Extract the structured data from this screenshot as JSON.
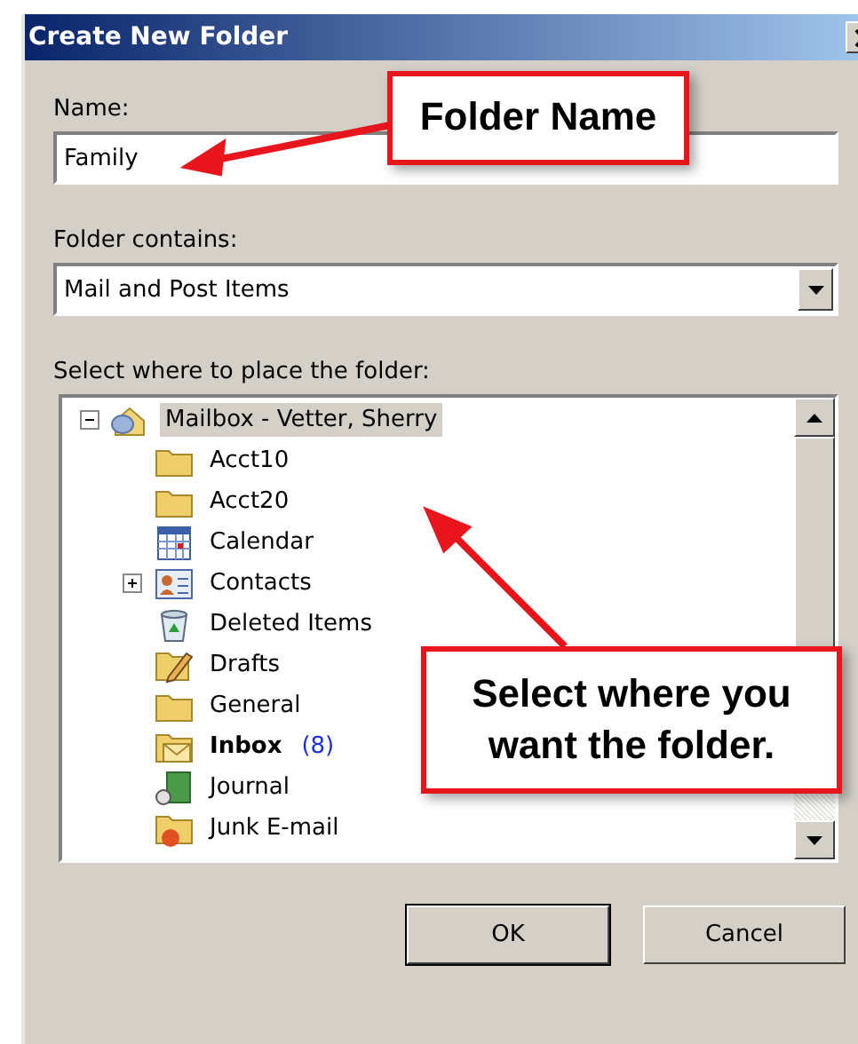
{
  "window": {
    "title": "Create New Folder"
  },
  "name_field": {
    "label": "Name:",
    "value": "Family"
  },
  "contains_field": {
    "label": "Folder contains:",
    "value": "Mail and Post Items"
  },
  "tree": {
    "label": "Select where to place the folder:",
    "root": {
      "label": "Mailbox - Vetter, Sherry",
      "kind": "mailbox",
      "selected": true,
      "expanded": true,
      "children": [
        {
          "label": "Acct10",
          "kind": "folder",
          "selected": false
        },
        {
          "label": "Acct20",
          "kind": "folder",
          "selected": false
        },
        {
          "label": "Calendar",
          "kind": "calendar",
          "selected": false
        },
        {
          "label": "Contacts",
          "kind": "contacts",
          "selected": false,
          "expanded": false
        },
        {
          "label": "Deleted Items",
          "kind": "deleted",
          "selected": false
        },
        {
          "label": "Drafts",
          "kind": "drafts",
          "selected": false
        },
        {
          "label": "General",
          "kind": "folder",
          "selected": false
        },
        {
          "label": "Inbox",
          "kind": "inbox",
          "selected": false,
          "count": "(8)"
        },
        {
          "label": "Journal",
          "kind": "journal",
          "selected": false
        },
        {
          "label": "Junk E-mail",
          "kind": "junk",
          "selected": false
        }
      ]
    }
  },
  "buttons": [
    {
      "label": "OK",
      "default": true
    },
    {
      "label": "Cancel",
      "default": false
    }
  ],
  "callouts": [
    {
      "text": "Folder Name"
    },
    {
      "text": "Select where you want the folder."
    }
  ]
}
